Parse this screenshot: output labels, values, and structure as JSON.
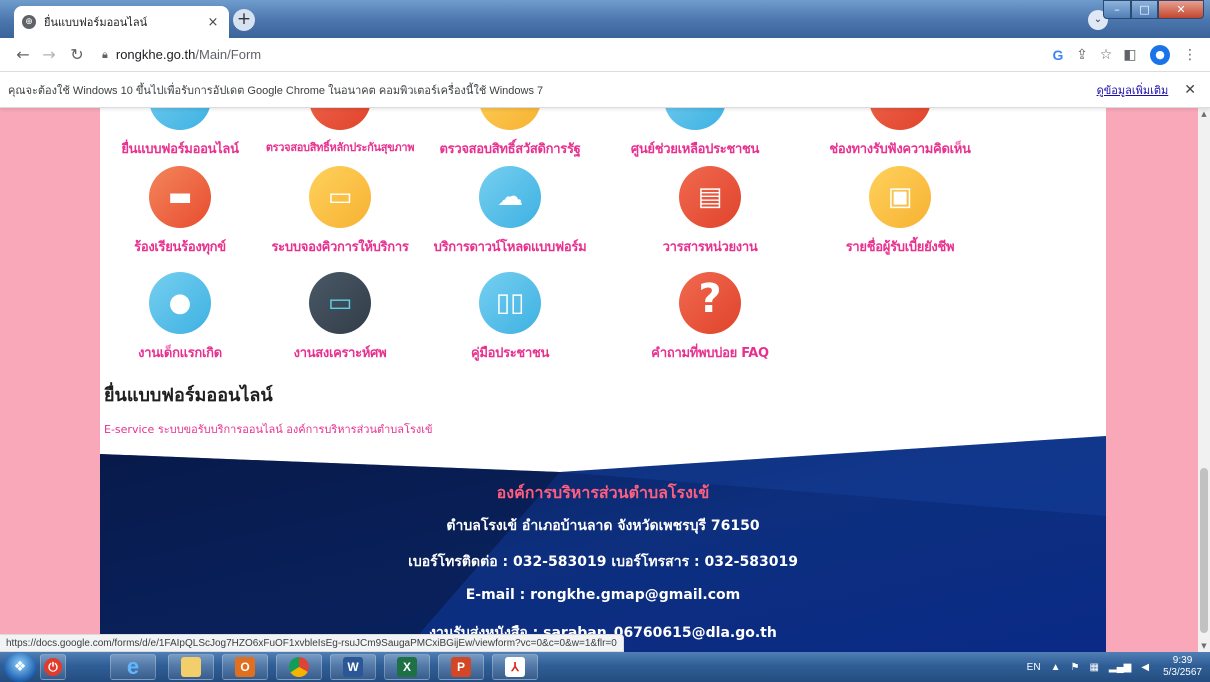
{
  "browser": {
    "tab_title": "ยื่นแบบฟอร์มออนไลน์",
    "tab_close": "×",
    "new_tab": "+",
    "url_host": "rongkhe.go.th",
    "url_path": "/Main/Form"
  },
  "infobar": {
    "message": "คุณจะต้องใช้ Windows 10 ขึ้นไปเพื่อรับการอัปเดต Google Chrome ในอนาคต คอมพิวเตอร์เครื่องนี้ใช้ Windows 7",
    "link": "ดูข้อมูลเพิ่มเติม",
    "close": "✕"
  },
  "services": [
    {
      "label": "ยื่นแบบฟอร์มออนไลน์",
      "color": "blue",
      "icon": "form-icon"
    },
    {
      "label": "ตรวจสอบสิทธิ์หลักประกันสุขภาพ",
      "color": "red",
      "icon": "health-icon"
    },
    {
      "label": "ตรวจสอบสิทธิ์สวัสดิการรัฐ",
      "color": "yellow",
      "icon": "welfare-icon"
    },
    {
      "label": "ศูนย์ช่วยเหลือประชาชน",
      "color": "blue",
      "icon": "help-center-icon"
    },
    {
      "label": "ช่องทางรับฟังความคิดเห็น",
      "color": "red",
      "icon": "feedback-icon"
    },
    {
      "label": "ร้องเรียนร้องทุกข์",
      "color": "orange",
      "icon": "chat-bubble-icon"
    },
    {
      "label": "ระบบจองคิวการให้บริการ",
      "color": "yellow",
      "icon": "monitor-icon"
    },
    {
      "label": "บริการดาวน์โหลดแบบฟอร์ม",
      "color": "blue",
      "icon": "cloud-download-icon"
    },
    {
      "label": "วารสารหน่วยงาน",
      "color": "red",
      "icon": "journal-icon"
    },
    {
      "label": "รายชื่อผู้รับเบี้ยยังชีพ",
      "color": "yellow",
      "icon": "id-card-icon"
    },
    {
      "label": "งานเด็กแรกเกิด",
      "color": "blue",
      "icon": "piggy-bank-icon"
    },
    {
      "label": "งานสงเคราะห์ศพ",
      "color": "dark",
      "icon": "money-card-icon"
    },
    {
      "label": "คู่มือประชาชน",
      "color": "blue",
      "icon": "book-icon"
    },
    {
      "label": "คำถามที่พบบ่อย FAQ",
      "color": "red",
      "icon": "question-icon"
    }
  ],
  "page": {
    "heading": "ยื่นแบบฟอร์มออนไลน์",
    "subheading": "E-service ระบบขอรับบริการออนไลน์ องค์การบริหารส่วนตำบลโรงเข้"
  },
  "footer": {
    "org": "องค์การบริหารส่วนตำบลโรงเข้",
    "address": "ตำบลโรงเข้ อำเภอบ้านลาด จังหวัดเพชรบุรี 76150",
    "phone": "เบอร์โทรติดต่อ : 032-583019 เบอร์โทรสาร : 032-583019",
    "email": "E-mail : rongkhe.gmap@gmail.com",
    "saraban": "งานรับส่งหนังสือ : saraban_06760615@dla.go.th"
  },
  "status_url": "https://docs.google.com/forms/d/e/1FAIpQLScJog7HZO6xFuOF1xvbleIsEg-rsuJCm9SaugaPMCxiBGijEw/viewform?vc=0&c=0&w=1&flr=0",
  "taskbar": {
    "lang": "EN",
    "time": "9:39",
    "date": "5/3/2567"
  },
  "colors": {
    "accent_pink": "#e8318f",
    "page_bg": "#f8a8b8",
    "footer_blue": "#0b2a6e"
  }
}
